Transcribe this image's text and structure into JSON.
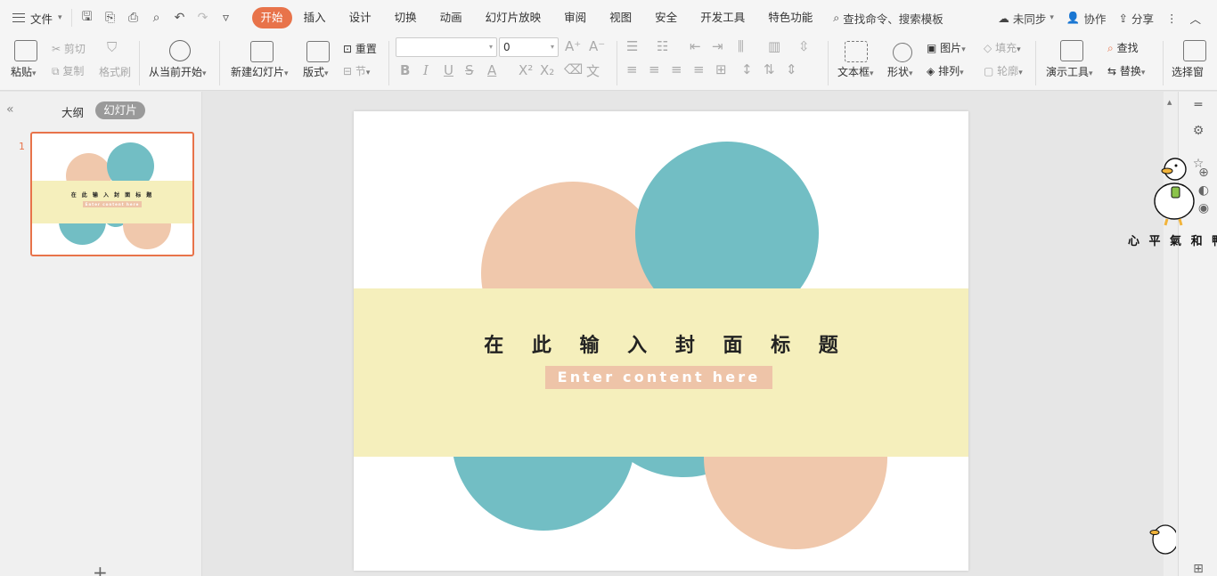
{
  "menubar": {
    "file_label": "文件",
    "tabs": [
      "开始",
      "插入",
      "设计",
      "切换",
      "动画",
      "幻灯片放映",
      "审阅",
      "视图",
      "安全",
      "开发工具",
      "特色功能"
    ],
    "active_tab": "开始",
    "search_label": "查找命令、搜索模板",
    "sync_label": "未同步",
    "collab_label": "协作",
    "share_label": "分享"
  },
  "ribbon": {
    "paste": "粘贴",
    "cut": "剪切",
    "copy": "复制",
    "format_painter": "格式刷",
    "from_current": "从当前开始",
    "new_slide": "新建幻灯片",
    "layout": "版式",
    "reset": "重置",
    "section": "节",
    "font_size_value": "0",
    "textbox": "文本框",
    "shape": "形状",
    "picture": "图片",
    "arrange": "排列",
    "fill": "填充",
    "outline": "轮廓",
    "present_tools": "演示工具",
    "find": "查找",
    "replace": "替换",
    "select_pane": "选择窗"
  },
  "leftpanel": {
    "outline_tab": "大纲",
    "slides_tab": "幻灯片",
    "slide_number": "1"
  },
  "slide": {
    "title": "在 此 输 入 封 面 标 题",
    "subtitle": "Enter content here",
    "colors": {
      "peach": "#f0c8ac",
      "teal": "#72bec4",
      "band": "#f5efbc",
      "subtitle_bg": "#eec4a8"
    }
  },
  "watermark": {
    "duck_caption": "心 平 氣 和 鸭"
  },
  "colors": {
    "accent": "#e8734a"
  }
}
